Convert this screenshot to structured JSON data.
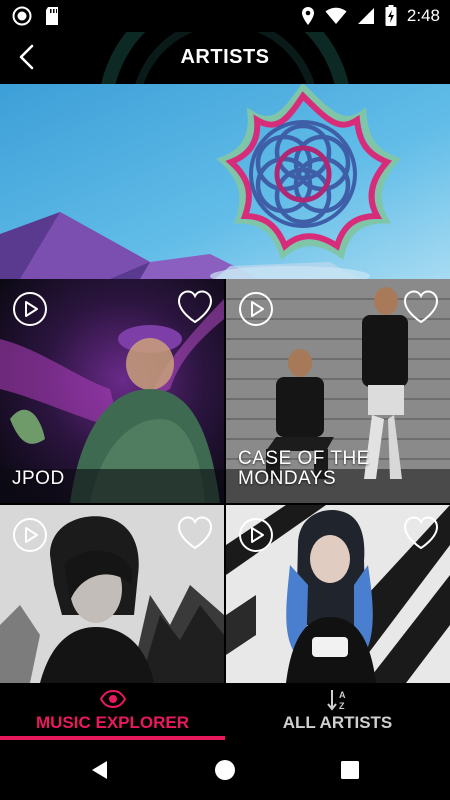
{
  "status": {
    "time": "2:48"
  },
  "header": {
    "title": "ARTISTS"
  },
  "artists": [
    {
      "name": "JPOD"
    },
    {
      "name": "CASE OF THE MONDAYS"
    },
    {
      "name": ""
    },
    {
      "name": ""
    }
  ],
  "bottom_nav": {
    "tabs": [
      {
        "label": "MUSIC EXPLORER",
        "active": true
      },
      {
        "label": "ALL ARTISTS",
        "active": false
      }
    ]
  },
  "colors": {
    "accent": "#e8195c",
    "inactive": "#cfcfcf"
  },
  "icons": [
    "back-arrow-icon",
    "play-icon",
    "heart-icon",
    "eye-icon",
    "sort-az-icon"
  ]
}
